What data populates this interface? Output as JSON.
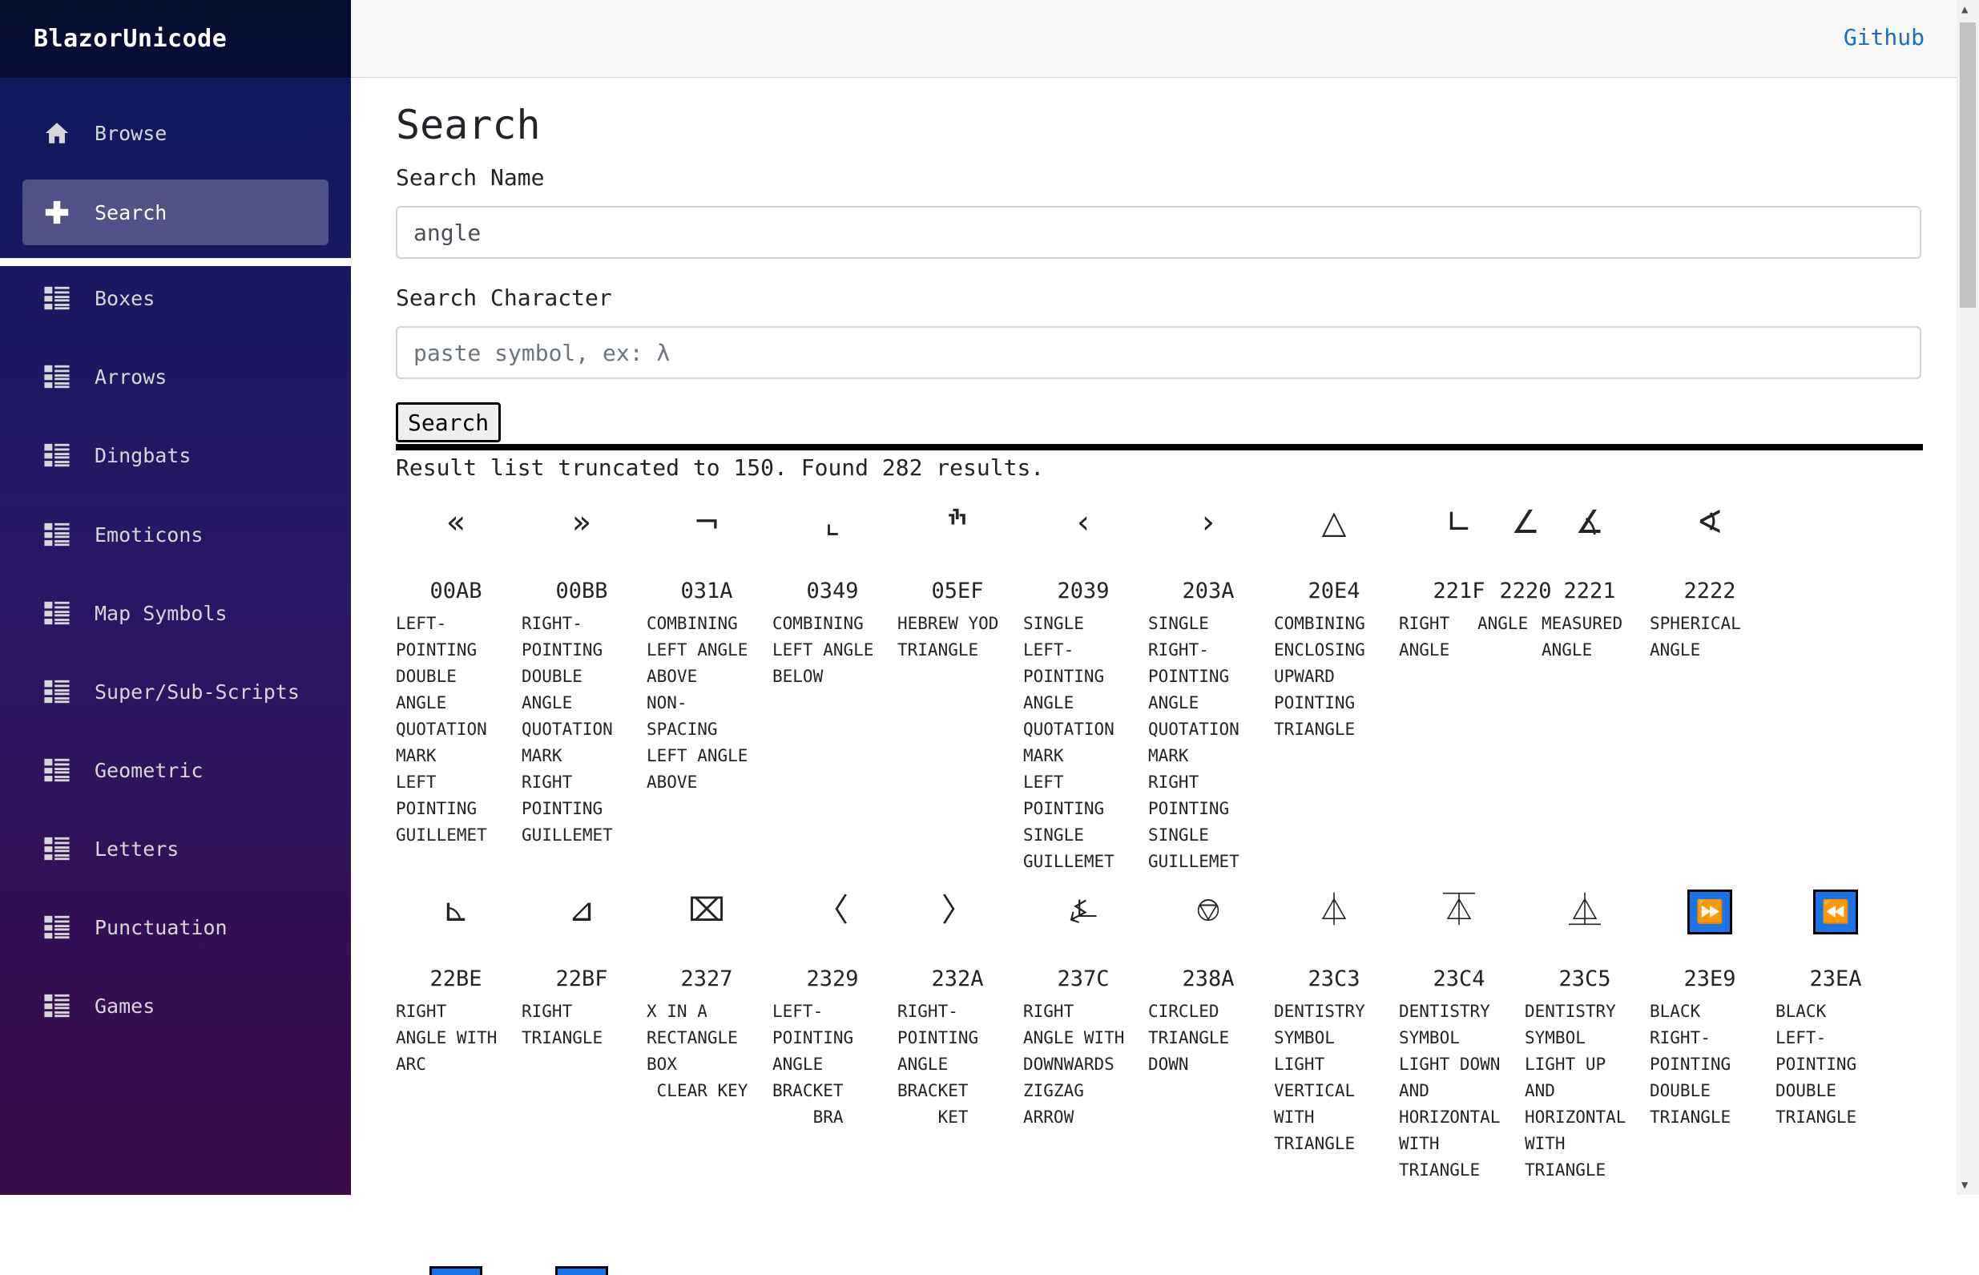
{
  "brand": "BlazorUnicode",
  "topbar": {
    "github": "Github"
  },
  "nav": [
    {
      "label": "Browse",
      "icon": "home-icon"
    },
    {
      "label": "Search",
      "icon": "plus-icon"
    },
    {
      "label": "Boxes",
      "icon": "list-icon"
    },
    {
      "label": "Arrows",
      "icon": "list-icon"
    },
    {
      "label": "Dingbats",
      "icon": "list-icon"
    },
    {
      "label": "Emoticons",
      "icon": "list-icon"
    },
    {
      "label": "Map Symbols",
      "icon": "list-icon"
    },
    {
      "label": "Super/Sub-Scripts",
      "icon": "list-icon"
    },
    {
      "label": "Geometric",
      "icon": "list-icon"
    },
    {
      "label": "Letters",
      "icon": "list-icon"
    },
    {
      "label": "Punctuation",
      "icon": "list-icon"
    },
    {
      "label": "Games",
      "icon": "list-icon"
    }
  ],
  "page": {
    "title": "Search",
    "search_name_label": "Search Name",
    "search_name_value": "angle",
    "search_char_label": "Search Character",
    "search_char_placeholder": "paste symbol, ex: λ",
    "search_button": "Search",
    "result_message": "Result list truncated to 150. Found 282 results."
  },
  "results": [
    {
      "char": "«",
      "code": "00AB",
      "name": "LEFT-\nPOINTING\nDOUBLE\nANGLE\nQUOTATION\nMARK\nLEFT\nPOINTING\nGUILLEMET"
    },
    {
      "char": "»",
      "code": "00BB",
      "name": "RIGHT-\nPOINTING\nDOUBLE\nANGLE\nQUOTATION\nMARK\nRIGHT\nPOINTING\nGUILLEMET"
    },
    {
      "char": "¬",
      "code": "031A",
      "name": "COMBINING\nLEFT ANGLE\nABOVE\nNON-\nSPACING\nLEFT ANGLE\nABOVE"
    },
    {
      "char": "⌞",
      "code": "0349",
      "name": "COMBINING\nLEFT ANGLE\nBELOW"
    },
    {
      "char": "ׯ",
      "code": "05EF",
      "name": "HEBREW YOD\nTRIANGLE"
    },
    {
      "char": "‹",
      "code": "2039",
      "name": "SINGLE\nLEFT-\nPOINTING\nANGLE\nQUOTATION\nMARK\nLEFT\nPOINTING\nSINGLE\nGUILLEMET"
    },
    {
      "char": "›",
      "code": "203A",
      "name": "SINGLE\nRIGHT-\nPOINTING\nANGLE\nQUOTATION\nMARK\nRIGHT\nPOINTING\nSINGLE\nGUILLEMET"
    },
    {
      "char": "△",
      "code": "20E4",
      "name": "COMBINING\nENCLOSING\nUPWARD\nPOINTING\nTRIANGLE"
    },
    {
      "char": "∟",
      "code": "221F",
      "name": "RIGHT\nANGLE"
    },
    {
      "char": "∠",
      "code": "2220",
      "name": "ANGLE"
    },
    {
      "char": "∡",
      "code": "2221",
      "name": "MEASURED\nANGLE"
    },
    {
      "char": "∢",
      "code": "2222",
      "name": "SPHERICAL\nANGLE"
    },
    {
      "char": "⊾",
      "code": "22BE",
      "name": "RIGHT\nANGLE WITH\nARC"
    },
    {
      "char": "⊿",
      "code": "22BF",
      "name": "RIGHT\nTRIANGLE"
    },
    {
      "char": "⌧",
      "code": "2327",
      "name": "X IN A\nRECTANGLE\nBOX\n CLEAR KEY"
    },
    {
      "char": "〈",
      "code": "2329",
      "name": "LEFT-\nPOINTING\nANGLE\nBRACKET\n    BRA"
    },
    {
      "char": "〉",
      "code": "232A",
      "name": "RIGHT-\nPOINTING\nANGLE\nBRACKET\n    KET"
    },
    {
      "char": "⍼",
      "code": "237C",
      "name": "RIGHT\nANGLE WITH\nDOWNWARDS\nZIGZAG\nARROW"
    },
    {
      "char": "⎊",
      "code": "238A",
      "name": "CIRCLED\nTRIANGLE\nDOWN"
    },
    {
      "char": "⏃",
      "code": "23C3",
      "name": "DENTISTRY\nSYMBOL\nLIGHT\nVERTICAL\nWITH\nTRIANGLE"
    },
    {
      "char": "⏄",
      "code": "23C4",
      "name": "DENTISTRY\nSYMBOL\nLIGHT DOWN\nAND\nHORIZONTAL\nWITH\nTRIANGLE"
    },
    {
      "char": "⏅",
      "code": "23C5",
      "name": "DENTISTRY\nSYMBOL\nLIGHT UP\nAND\nHORIZONTAL\nWITH\nTRIANGLE"
    },
    {
      "char": "⏩",
      "code": "23E9",
      "name": "BLACK\nRIGHT-\nPOINTING\nDOUBLE\nTRIANGLE",
      "boxed": true,
      "box_color": "#1a73e8"
    },
    {
      "char": "⏪",
      "code": "23EA",
      "name": "BLACK\nLEFT-\nPOINTING\nDOUBLE\nTRIANGLE",
      "boxed": true,
      "box_color": "#1a73e8"
    }
  ]
}
